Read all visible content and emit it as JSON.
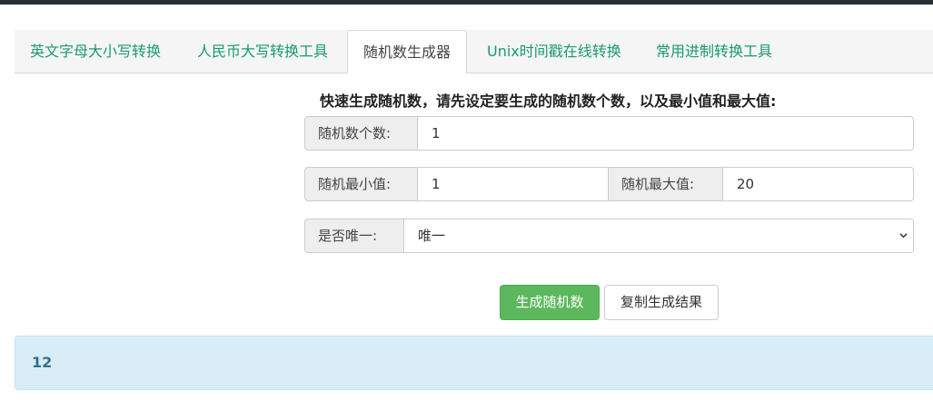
{
  "tabs": [
    {
      "label": "英文字母大小写转换"
    },
    {
      "label": "人民币大写转换工具"
    },
    {
      "label": "随机数生成器"
    },
    {
      "label": "Unix时间戳在线转换"
    },
    {
      "label": "常用进制转换工具"
    }
  ],
  "form": {
    "heading": "快速生成随机数，请先设定要生成的随机数个数，以及最小值和最大值:",
    "count_label": "随机数个数:",
    "count_value": "1",
    "min_label": "随机最小值:",
    "min_value": "1",
    "max_label": "随机最大值:",
    "max_value": "20",
    "unique_label": "是否唯一:",
    "unique_selected": "唯一"
  },
  "buttons": {
    "generate_label": "生成随机数",
    "copy_label": "复制生成结果"
  },
  "result": {
    "value": "12"
  },
  "colors": {
    "tab_link": "#1a9b6c",
    "generate_button": "#5cb85c",
    "result_bg": "#d9edf7",
    "result_text": "#31708f"
  },
  "icons": {
    "select_arrow": "chevron-down-icon"
  }
}
